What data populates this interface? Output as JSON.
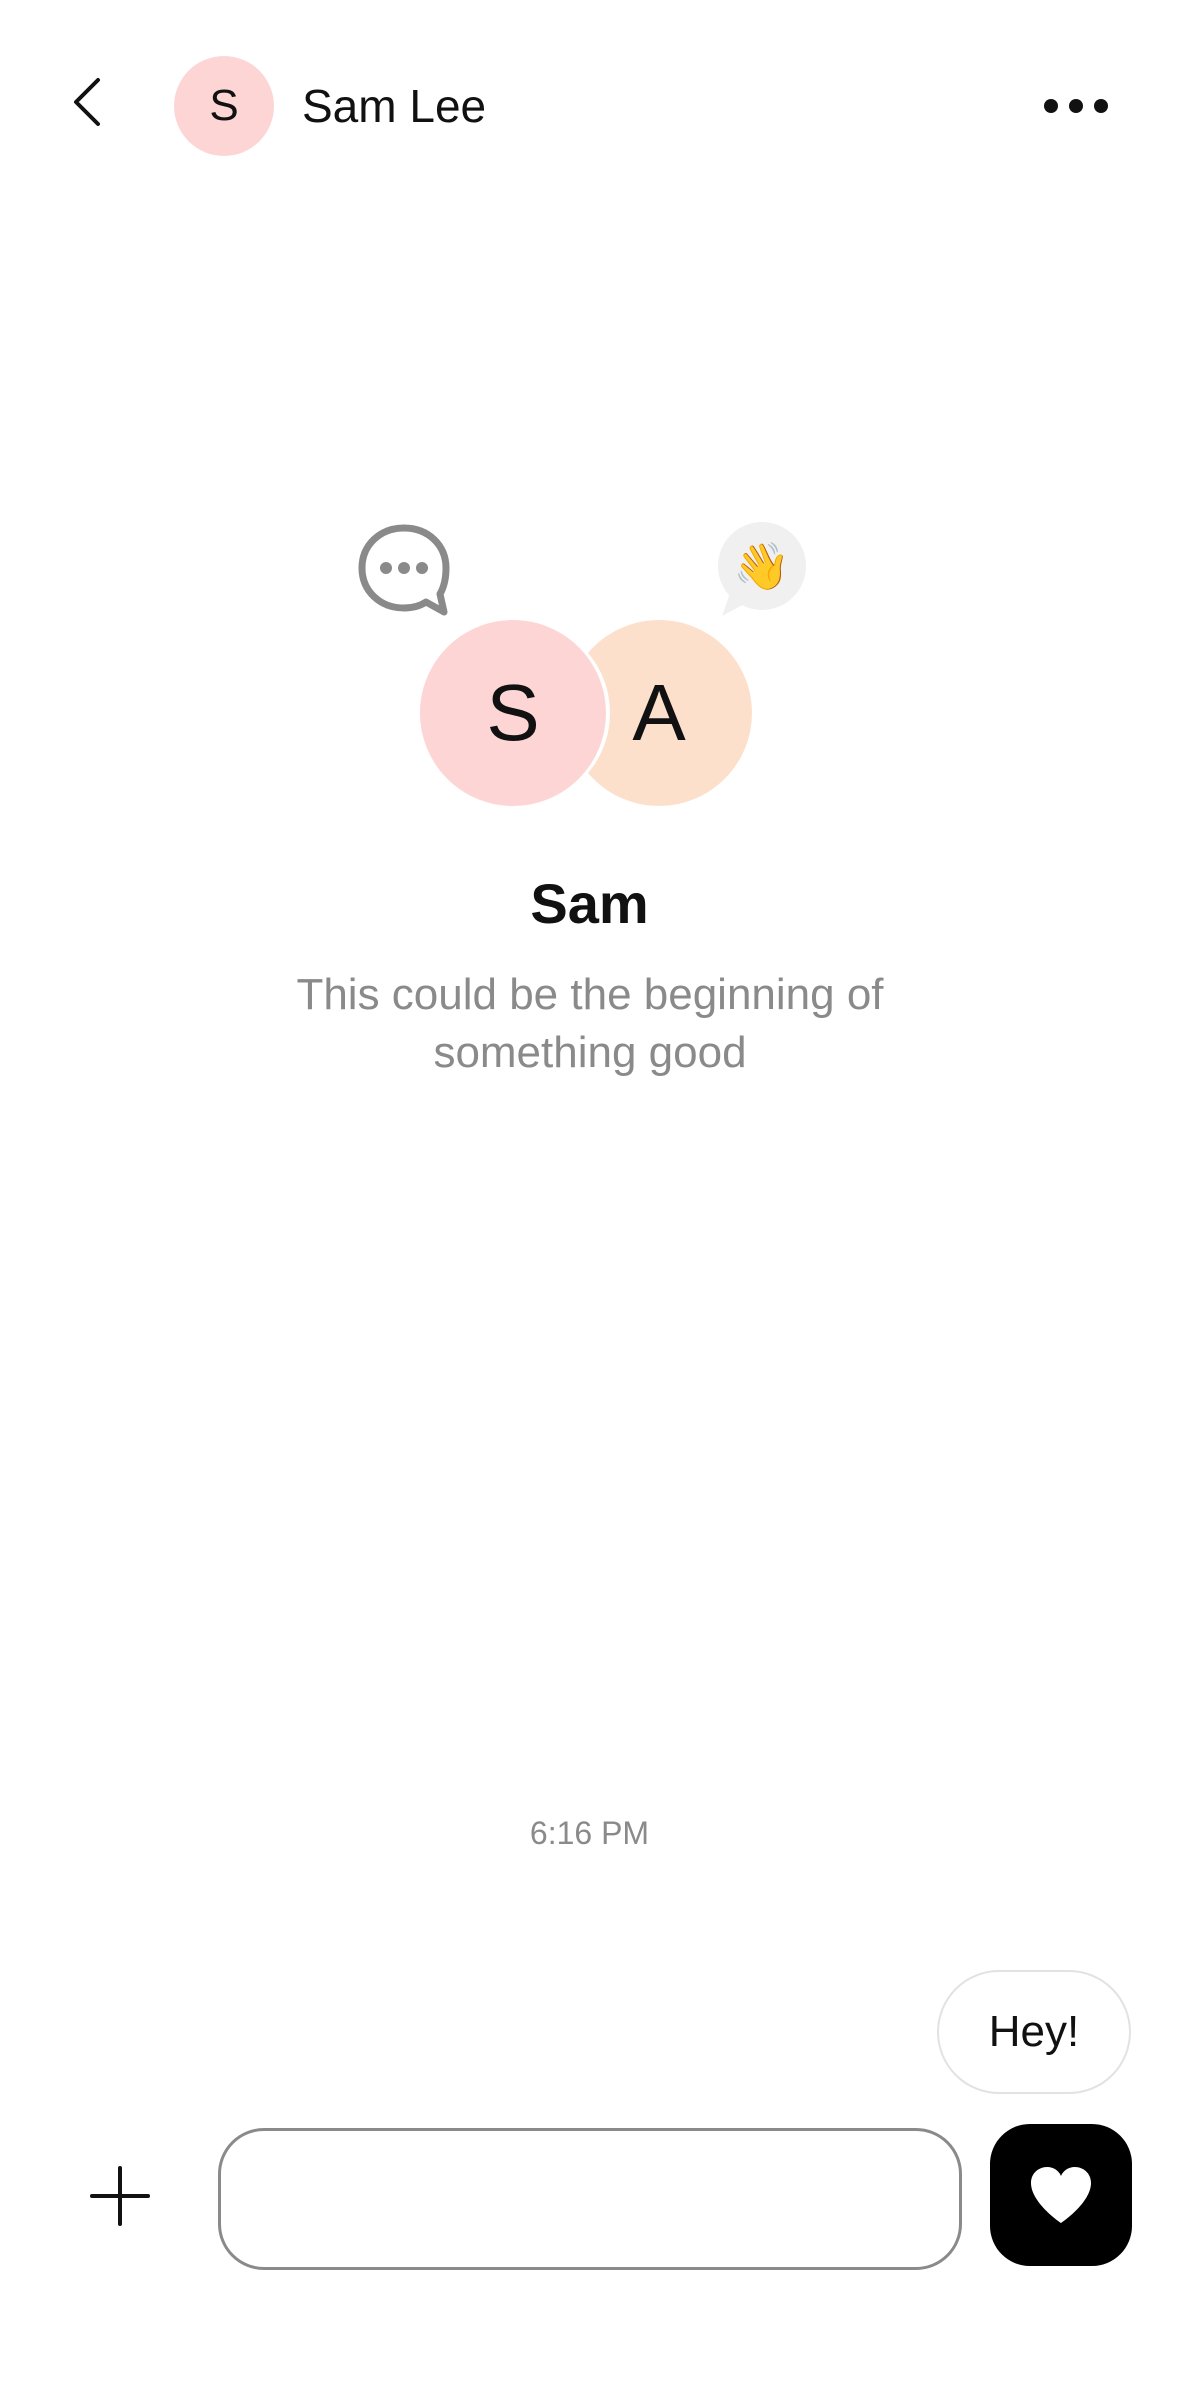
{
  "header": {
    "avatar_initial": "S",
    "contact_name": "Sam Lee"
  },
  "intro": {
    "avatar_left_initial": "S",
    "avatar_right_initial": "A",
    "wave_emoji": "👋",
    "name": "Sam",
    "subtitle": "This could be the beginning of something good"
  },
  "messages": [
    {
      "text": "Hey!",
      "sender": "self"
    }
  ],
  "timestamp": "6:16 PM",
  "composer": {
    "placeholder": ""
  },
  "colors": {
    "avatar_pink": "#fdd5d5",
    "avatar_peach": "#fde0cc",
    "muted_text": "#8a8a8a",
    "like_button": "#000000"
  },
  "icons": {
    "back": "chevron-left-icon",
    "more": "more-horizontal-icon",
    "chat": "chat-bubble-icon",
    "add": "plus-icon",
    "like": "heart-icon"
  }
}
